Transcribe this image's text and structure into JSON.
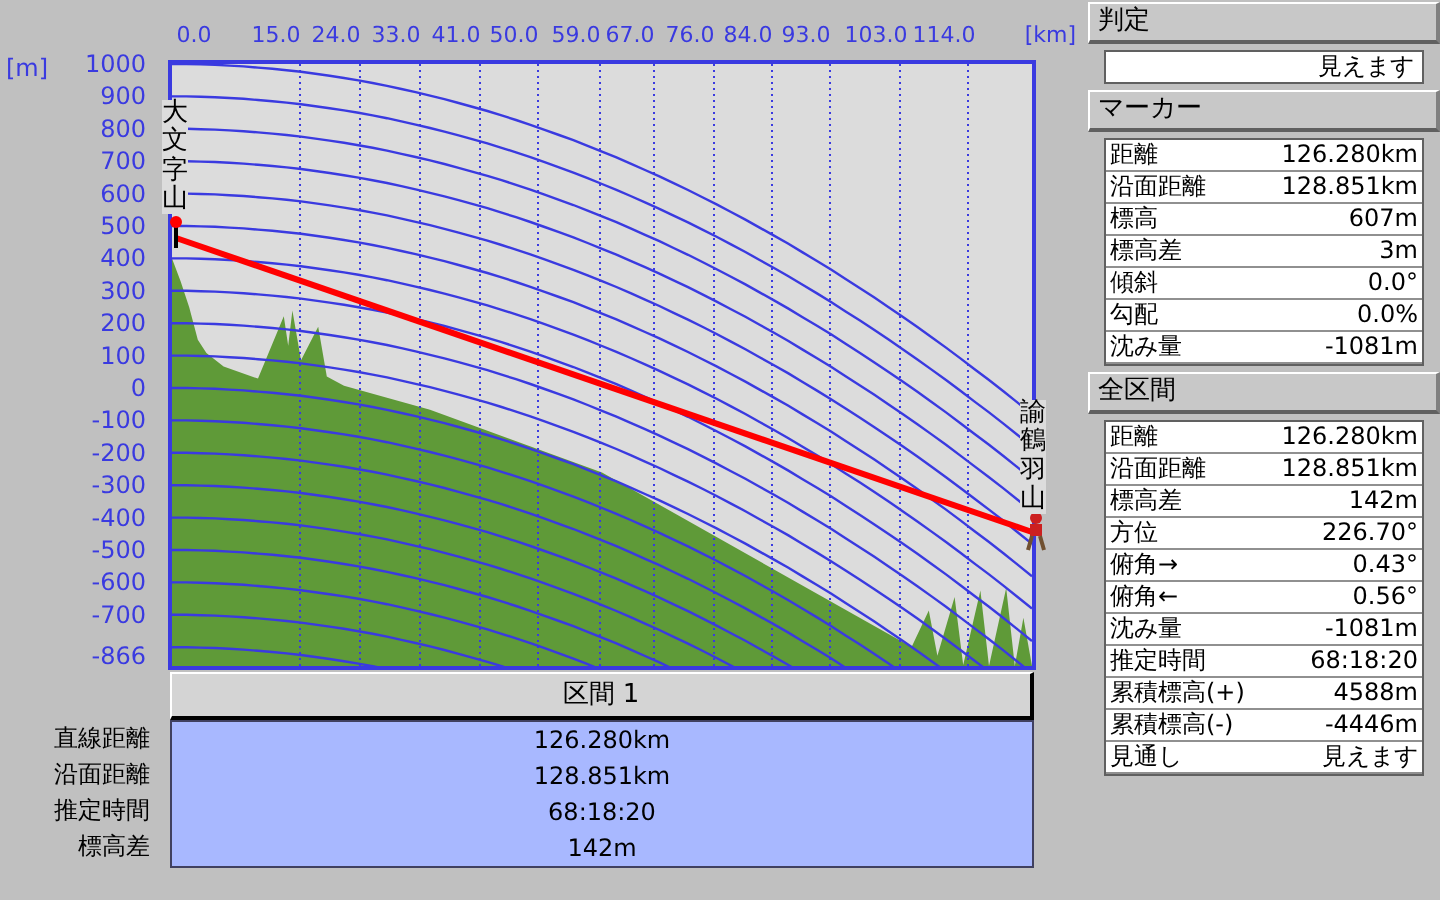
{
  "chart": {
    "x_unit": "[km]",
    "y_unit": "[m]",
    "x_ticks": [
      "0.0",
      "15.0",
      "24.0",
      "33.0",
      "41.0",
      "50.0",
      "59.0",
      "67.0",
      "76.0",
      "84.0",
      "93.0",
      "103.0",
      "114.0"
    ],
    "y_ticks": [
      "1000",
      "900",
      "800",
      "700",
      "600",
      "500",
      "400",
      "300",
      "200",
      "100",
      "0",
      "-100",
      "-200",
      "-300",
      "-400",
      "-500",
      "-600",
      "-700",
      "-866"
    ],
    "start_label": "大文字山",
    "end_label": "諭鶴羽山"
  },
  "section_header": "区間 1",
  "section_rows": [
    {
      "label": "直線距離",
      "value": "126.280km"
    },
    {
      "label": "沿面距離",
      "value": "128.851km"
    },
    {
      "label": "推定時間",
      "value": "68:18:20"
    },
    {
      "label": "標高差",
      "value": "142m"
    }
  ],
  "judgement": {
    "title": "判定",
    "value": "見えます"
  },
  "marker": {
    "title": "マーカー",
    "rows": [
      {
        "label": "距離",
        "value": "126.280km"
      },
      {
        "label": "沿面距離",
        "value": "128.851km"
      },
      {
        "label": "標高",
        "value": "607m"
      },
      {
        "label": "標高差",
        "value": "3m"
      },
      {
        "label": "傾斜",
        "value": "0.0°"
      },
      {
        "label": "勾配",
        "value": "0.0%"
      },
      {
        "label": "沈み量",
        "value": "-1081m"
      }
    ]
  },
  "whole": {
    "title": "全区間",
    "rows": [
      {
        "label": "距離",
        "value": "126.280km"
      },
      {
        "label": "沿面距離",
        "value": "128.851km"
      },
      {
        "label": "標高差",
        "value": "142m"
      },
      {
        "label": "方位",
        "value": "226.70°"
      },
      {
        "label": "俯角→",
        "value": "0.43°"
      },
      {
        "label": "俯角←",
        "value": "0.56°"
      },
      {
        "label": "沈み量",
        "value": "-1081m"
      },
      {
        "label": "推定時間",
        "value": "68:18:20"
      },
      {
        "label": "累積標高(+)",
        "value": "4588m"
      },
      {
        "label": "累積標高(-)",
        "value": "-4446m"
      },
      {
        "label": "見通し",
        "value": "見えます"
      }
    ]
  }
}
